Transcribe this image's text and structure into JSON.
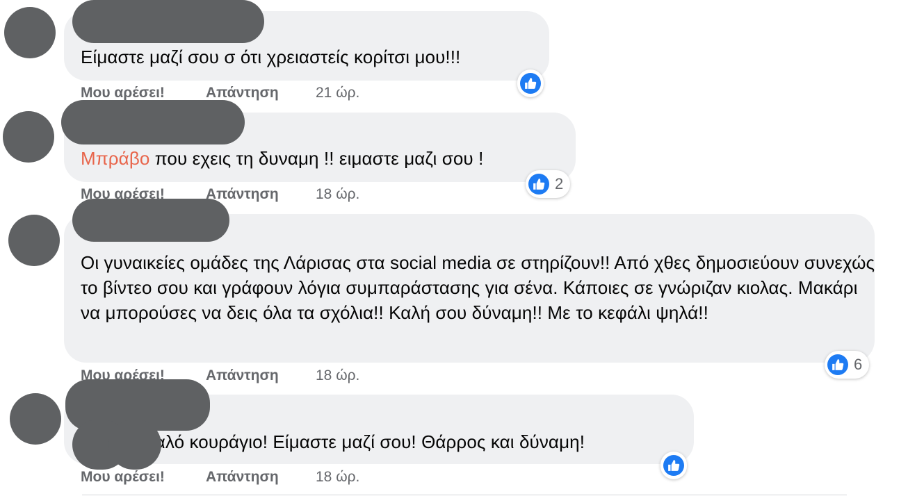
{
  "colors": {
    "like_blue": "#1d7bf3",
    "mention": "#e8654b",
    "bubble": "#eff0f2",
    "redaction": "#5f6163"
  },
  "comments": [
    {
      "text": "Είμαστε μαζί σου σ ότι χρειαστείς κορίτσι μου!!!",
      "like": "Μου αρέσει!",
      "reply": "Απάντηση",
      "time": "21 ώρ.",
      "reaction_icon": "like-icon",
      "reaction_count": ""
    },
    {
      "mention": "Μπράβο",
      "text": " που εχεις τη δυναμη !! ειμαστε μαζι σου !",
      "like": "Μου αρέσει!",
      "reply": "Απάντηση",
      "time": "18 ώρ.",
      "reaction_icon": "like-icon",
      "reaction_count": "2"
    },
    {
      "text": "Οι γυναικείες ομάδες της Λάρισας στα social media σε στηρίζουν!! Από χθες δημοσιεύουν συνεχώς το βίντεο σου και γράφουν λόγια συμπαράστασης για σένα. Κάποιες σε γνώριζαν κιολας. Μακάρι να μπορούσες να δεις όλα τα σχόλια!! Καλή σου δύναμη!! Με το κεφάλι ψηλά!!",
      "like": "Μου αρέσει!",
      "reply": "Απάντηση",
      "time": "18 ώρ.",
      "reaction_icon": "like-icon",
      "reaction_count": "6"
    },
    {
      "text": "καλό κουράγιο! Είμαστε μαζί σου! Θάρρος και δύναμη!",
      "like": "Μου αρέσει!",
      "reply": "Απάντηση",
      "time": "18 ώρ.",
      "reaction_icon": "like-icon",
      "reaction_count": ""
    }
  ]
}
